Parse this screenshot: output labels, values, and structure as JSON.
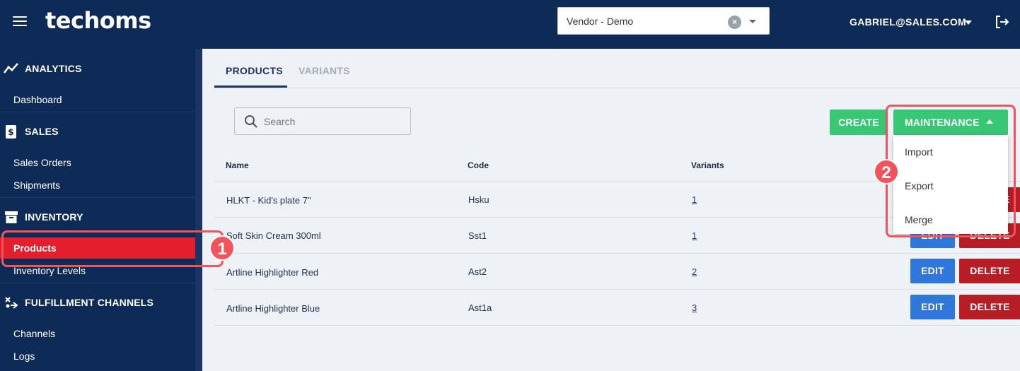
{
  "topbar": {
    "logo": "techoms",
    "vendor_value": "Vendor - Demo",
    "user_email": "GABRIEL@SALES.COM"
  },
  "sidebar": {
    "sections": [
      {
        "label": "ANALYTICS",
        "icon": "analytics-icon",
        "items": [
          "Dashboard"
        ]
      },
      {
        "label": "SALES",
        "icon": "dollar-doc-icon",
        "items": [
          "Sales Orders",
          "Shipments"
        ]
      },
      {
        "label": "INVENTORY",
        "icon": "archive-box-icon",
        "items": [
          "Products",
          "Inventory Levels"
        ]
      },
      {
        "label": "FULFILLMENT CHANNELS",
        "icon": "channels-icon",
        "items": [
          "Channels",
          "Logs"
        ]
      }
    ],
    "active_item": "Products"
  },
  "tabs": [
    "PRODUCTS",
    "VARIANTS"
  ],
  "search": {
    "placeholder": "Search"
  },
  "actions": {
    "create": "CREATE",
    "maintenance": "MAINTENANCE"
  },
  "maintenance_menu": [
    "Import",
    "Export",
    "Merge"
  ],
  "table": {
    "headers": [
      "Name",
      "Code",
      "Variants"
    ],
    "rows": [
      {
        "name": "HLKT - Kid's plate 7\"",
        "code": "Hsku",
        "variants": "1"
      },
      {
        "name": "Soft Skin Cream 300ml",
        "code": "Sst1",
        "variants": "1"
      },
      {
        "name": "Artline Highlighter Red",
        "code": "Ast2",
        "variants": "2"
      },
      {
        "name": "Artline Highlighter Blue",
        "code": "Ast1a",
        "variants": "3"
      }
    ],
    "edit_label": "EDIT",
    "delete_label": "DELETE"
  },
  "annotations": {
    "badge1": "1",
    "badge2": "2"
  },
  "colors": {
    "nav": "#0e2a57",
    "active": "#e31e2d",
    "green": "#38c774",
    "edit": "#2f77db",
    "delete": "#b61d24",
    "highlight": "#f2545b"
  }
}
